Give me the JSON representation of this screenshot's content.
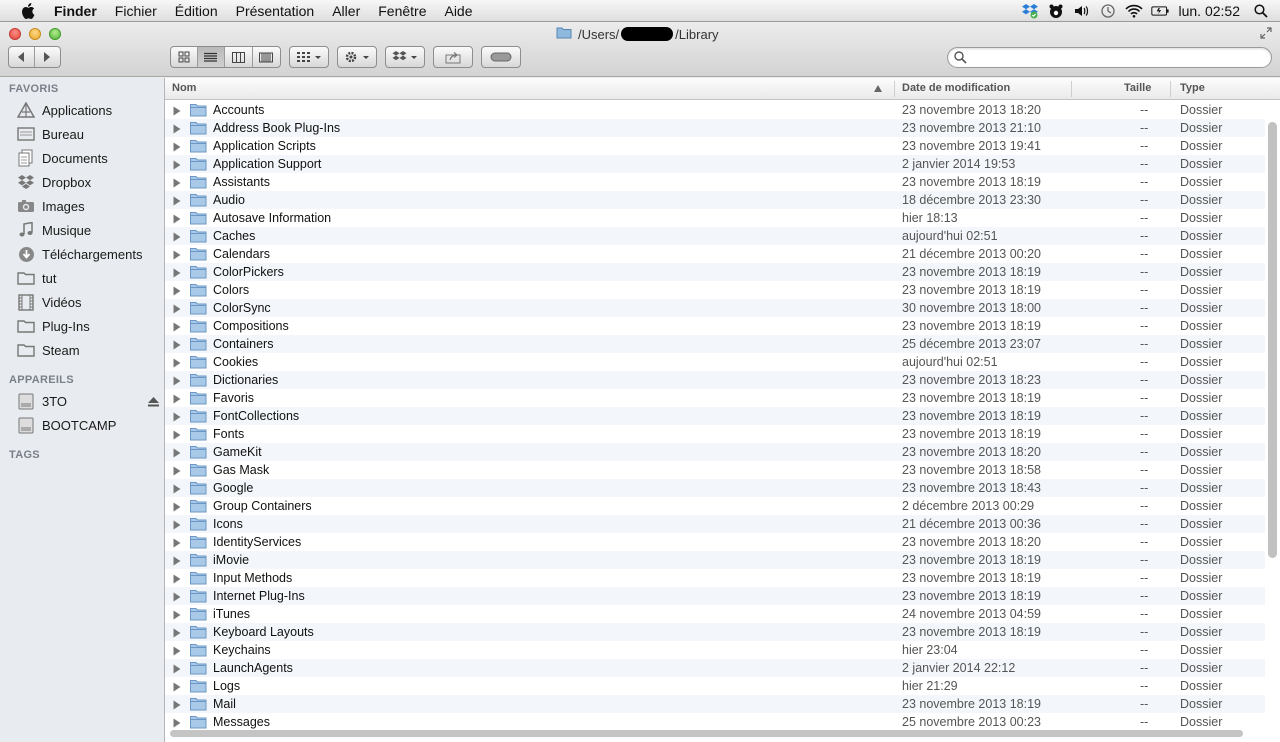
{
  "menubar": {
    "app": "Finder",
    "menus": [
      "Fichier",
      "Édition",
      "Présentation",
      "Aller",
      "Fenêtre",
      "Aide"
    ],
    "clock": "lun. 02:52"
  },
  "window": {
    "title_prefix": "/Users/",
    "title_suffix": "/Library",
    "search_placeholder": ""
  },
  "sidebar": {
    "favorites_header": "FAVORIS",
    "favorites": [
      {
        "label": "Applications",
        "icon": "applications-icon"
      },
      {
        "label": "Bureau",
        "icon": "desktop-icon"
      },
      {
        "label": "Documents",
        "icon": "documents-icon"
      },
      {
        "label": "Dropbox",
        "icon": "dropbox-icon"
      },
      {
        "label": "Images",
        "icon": "camera-icon"
      },
      {
        "label": "Musique",
        "icon": "music-icon"
      },
      {
        "label": "Téléchargements",
        "icon": "download-icon"
      },
      {
        "label": "tut",
        "icon": "folder-icon"
      },
      {
        "label": "Vidéos",
        "icon": "film-icon"
      },
      {
        "label": "Plug-Ins",
        "icon": "folder-icon"
      },
      {
        "label": "Steam",
        "icon": "folder-icon"
      }
    ],
    "devices_header": "APPAREILS",
    "devices": [
      {
        "label": "3TO",
        "icon": "disk-icon"
      },
      {
        "label": "BOOTCAMP",
        "icon": "disk-icon"
      }
    ],
    "tags_header": "TAGS"
  },
  "columns": {
    "name": "Nom",
    "date": "Date de modification",
    "size": "Taille",
    "kind": "Type"
  },
  "files": [
    {
      "name": "Accounts",
      "date": "23 novembre 2013 18:20",
      "size": "--",
      "kind": "Dossier"
    },
    {
      "name": "Address Book Plug-Ins",
      "date": "23 novembre 2013 21:10",
      "size": "--",
      "kind": "Dossier"
    },
    {
      "name": "Application Scripts",
      "date": "23 novembre 2013 19:41",
      "size": "--",
      "kind": "Dossier"
    },
    {
      "name": "Application Support",
      "date": "2 janvier 2014 19:53",
      "size": "--",
      "kind": "Dossier"
    },
    {
      "name": "Assistants",
      "date": "23 novembre 2013 18:19",
      "size": "--",
      "kind": "Dossier"
    },
    {
      "name": "Audio",
      "date": "18 décembre 2013 23:30",
      "size": "--",
      "kind": "Dossier"
    },
    {
      "name": "Autosave Information",
      "date": "hier 18:13",
      "size": "--",
      "kind": "Dossier"
    },
    {
      "name": "Caches",
      "date": "aujourd'hui 02:51",
      "size": "--",
      "kind": "Dossier"
    },
    {
      "name": "Calendars",
      "date": "21 décembre 2013 00:20",
      "size": "--",
      "kind": "Dossier"
    },
    {
      "name": "ColorPickers",
      "date": "23 novembre 2013 18:19",
      "size": "--",
      "kind": "Dossier"
    },
    {
      "name": "Colors",
      "date": "23 novembre 2013 18:19",
      "size": "--",
      "kind": "Dossier"
    },
    {
      "name": "ColorSync",
      "date": "30 novembre 2013 18:00",
      "size": "--",
      "kind": "Dossier"
    },
    {
      "name": "Compositions",
      "date": "23 novembre 2013 18:19",
      "size": "--",
      "kind": "Dossier"
    },
    {
      "name": "Containers",
      "date": "25 décembre 2013 23:07",
      "size": "--",
      "kind": "Dossier"
    },
    {
      "name": "Cookies",
      "date": "aujourd'hui 02:51",
      "size": "--",
      "kind": "Dossier"
    },
    {
      "name": "Dictionaries",
      "date": "23 novembre 2013 18:23",
      "size": "--",
      "kind": "Dossier"
    },
    {
      "name": "Favoris",
      "date": "23 novembre 2013 18:19",
      "size": "--",
      "kind": "Dossier"
    },
    {
      "name": "FontCollections",
      "date": "23 novembre 2013 18:19",
      "size": "--",
      "kind": "Dossier"
    },
    {
      "name": "Fonts",
      "date": "23 novembre 2013 18:19",
      "size": "--",
      "kind": "Dossier"
    },
    {
      "name": "GameKit",
      "date": "23 novembre 2013 18:20",
      "size": "--",
      "kind": "Dossier"
    },
    {
      "name": "Gas Mask",
      "date": "23 novembre 2013 18:58",
      "size": "--",
      "kind": "Dossier"
    },
    {
      "name": "Google",
      "date": "23 novembre 2013 18:43",
      "size": "--",
      "kind": "Dossier"
    },
    {
      "name": "Group Containers",
      "date": "2 décembre 2013 00:29",
      "size": "--",
      "kind": "Dossier"
    },
    {
      "name": "Icons",
      "date": "21 décembre 2013 00:36",
      "size": "--",
      "kind": "Dossier"
    },
    {
      "name": "IdentityServices",
      "date": "23 novembre 2013 18:20",
      "size": "--",
      "kind": "Dossier"
    },
    {
      "name": "iMovie",
      "date": "23 novembre 2013 18:19",
      "size": "--",
      "kind": "Dossier"
    },
    {
      "name": "Input Methods",
      "date": "23 novembre 2013 18:19",
      "size": "--",
      "kind": "Dossier"
    },
    {
      "name": "Internet Plug-Ins",
      "date": "23 novembre 2013 18:19",
      "size": "--",
      "kind": "Dossier"
    },
    {
      "name": "iTunes",
      "date": "24 novembre 2013 04:59",
      "size": "--",
      "kind": "Dossier"
    },
    {
      "name": "Keyboard Layouts",
      "date": "23 novembre 2013 18:19",
      "size": "--",
      "kind": "Dossier"
    },
    {
      "name": "Keychains",
      "date": "hier 23:04",
      "size": "--",
      "kind": "Dossier"
    },
    {
      "name": "LaunchAgents",
      "date": "2 janvier 2014 22:12",
      "size": "--",
      "kind": "Dossier"
    },
    {
      "name": "Logs",
      "date": "hier 21:29",
      "size": "--",
      "kind": "Dossier"
    },
    {
      "name": "Mail",
      "date": "23 novembre 2013 18:19",
      "size": "--",
      "kind": "Dossier"
    },
    {
      "name": "Messages",
      "date": "25 novembre 2013 00:23",
      "size": "--",
      "kind": "Dossier"
    }
  ]
}
